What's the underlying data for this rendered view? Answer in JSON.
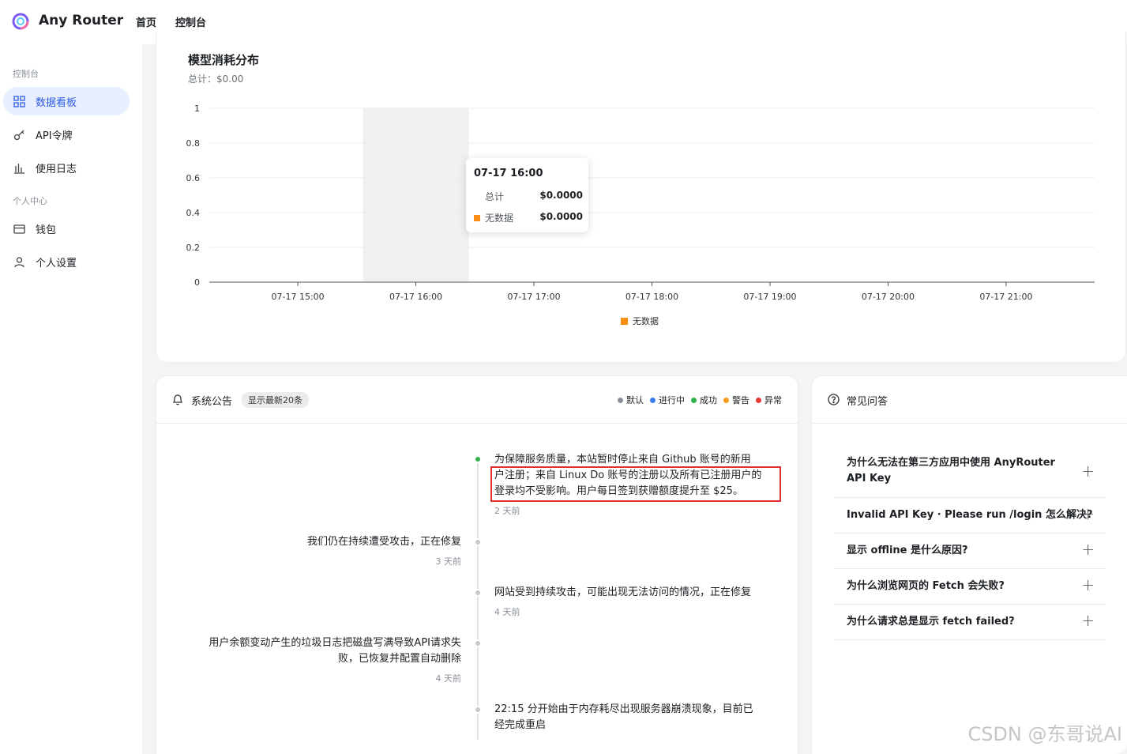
{
  "header": {
    "brand": "Any Router",
    "nav": [
      "首页",
      "控制台"
    ]
  },
  "sidebar": {
    "section1": "控制台",
    "items1": [
      {
        "label": "数据看板",
        "icon": "grid-icon",
        "active": true
      },
      {
        "label": "API令牌",
        "icon": "key-icon",
        "active": false
      },
      {
        "label": "使用日志",
        "icon": "bar-chart-icon",
        "active": false
      }
    ],
    "section2": "个人中心",
    "items2": [
      {
        "label": "钱包",
        "icon": "wallet-icon",
        "active": false
      },
      {
        "label": "个人设置",
        "icon": "user-icon",
        "active": false
      }
    ]
  },
  "chart": {
    "title": "模型消耗分布",
    "subtitle": "总计：$0.00",
    "tooltip": {
      "title": "07-17 16:00",
      "rows": [
        {
          "label": "总计",
          "value": "$0.0000"
        },
        {
          "label": "无数据",
          "value": "$0.0000"
        }
      ]
    }
  },
  "chart_data": {
    "type": "bar",
    "title": "模型消耗分布",
    "categories": [
      "07-17 15:00",
      "07-17 16:00",
      "07-17 17:00",
      "07-17 18:00",
      "07-17 19:00",
      "07-17 20:00",
      "07-17 21:00"
    ],
    "series": [
      {
        "name": "无数据",
        "values": [
          0,
          0,
          0,
          0,
          0,
          0,
          0
        ],
        "color": "#fa8c16"
      }
    ],
    "yticks": [
      "0",
      "0.2",
      "0.4",
      "0.6",
      "0.8",
      "1"
    ],
    "ylim": [
      0,
      1
    ],
    "grid": true,
    "legend": "bottom",
    "highlight_category": "07-17 16:00"
  },
  "announcements": {
    "title": "系统公告",
    "badge": "显示最新20条",
    "legend": [
      {
        "label": "默认",
        "color": "#8a8f99"
      },
      {
        "label": "进行中",
        "color": "#3b7ded"
      },
      {
        "label": "成功",
        "color": "#2fb24a"
      },
      {
        "label": "警告",
        "color": "#fa9c1b"
      },
      {
        "label": "异常",
        "color": "#e53935"
      }
    ],
    "items": [
      {
        "lines": [
          "为保障服务质量，本站暂时停止来自 Github 账号的新用",
          "户注册；来自 Linux Do 账号的注册以及所有已注册用户的",
          "登录均不受影响。用户每日签到获赠额度提升至 $25。"
        ],
        "time": "2 天前"
      },
      {
        "lines": [
          "我们仍在持续遭受攻击，正在修复"
        ],
        "time": "3 天前"
      },
      {
        "lines": [
          "网站受到持续攻击，可能出现无法访问的情况，正在修复"
        ],
        "time": "4 天前"
      },
      {
        "lines": [
          "用户余额变动产生的垃圾日志把磁盘写满导致API请求失",
          "败，已恢复并配置自动删除"
        ],
        "time": "4 天前"
      },
      {
        "lines": [
          "22:15 分开始由于内存耗尽出现服务器崩溃现象，目前已",
          "经完成重启"
        ],
        "time": ""
      }
    ]
  },
  "faq": {
    "title": "常见问答",
    "items": [
      {
        "lines": [
          "为什么无法在第三方应用中使用 AnyRouter",
          "API Key"
        ]
      },
      {
        "lines": [
          "Invalid API Key · Please run /login 怎么解决?"
        ]
      },
      {
        "lines": [
          "显示 offline 是什么原因?"
        ]
      },
      {
        "lines": [
          "为什么浏览网页的 Fetch 会失败?"
        ]
      },
      {
        "lines": [
          "为什么请求总是显示 fetch failed?"
        ]
      }
    ]
  },
  "watermark": "CSDN @东哥说AI"
}
